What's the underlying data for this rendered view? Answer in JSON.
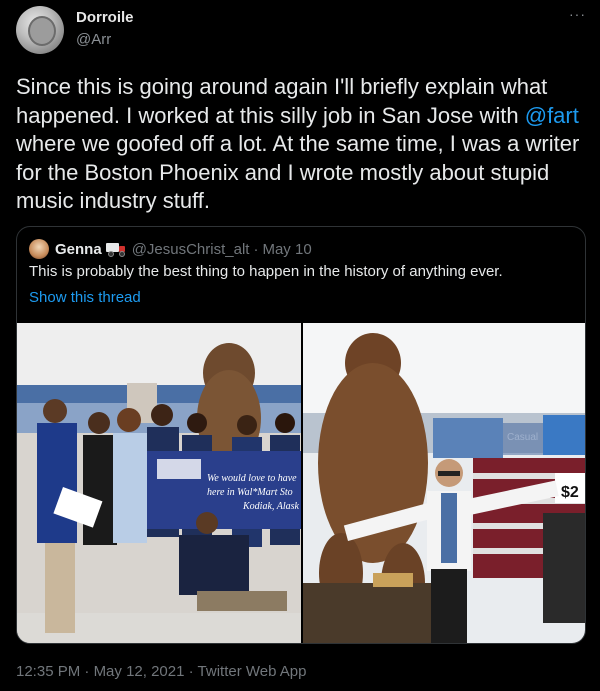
{
  "author": {
    "display_name": "Dorroile",
    "handle": "@Arr",
    "more": "···"
  },
  "tweet": {
    "text_before": "Since this is going around again I'll briefly explain what happened. I worked at this silly job in San Jose with ",
    "mention": "@fart",
    "text_after": " where we goofed off a lot. At the same time, I was a writer for the Boston Phoenix and I wrote mostly about stupid music industry stuff."
  },
  "quote": {
    "name": "Genna",
    "handle": "@JesusChrist_alt",
    "separator": "·",
    "date": "May 10",
    "text": "This is probably the best thing to happen in the history of anything ever.",
    "show_thread": "Show this thread",
    "banner_line1": "We would love to have",
    "banner_line2": "here in Wal*Mart Sto",
    "banner_line3": "Kodiak, Alask",
    "shelf_sign": "Casual",
    "price_tag": "$2"
  },
  "meta": {
    "time": "12:35 PM",
    "separator": " · ",
    "date": "May 12, 2021",
    "separator2": " · ",
    "client": "Twitter Web App"
  },
  "colors": {
    "background": "#000000",
    "accent": "#1d9bf0",
    "muted": "#71767b",
    "border": "#2f3336"
  }
}
